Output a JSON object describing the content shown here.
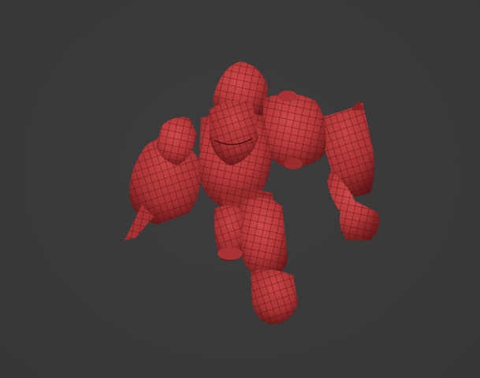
{
  "viewport": {
    "background_color": "#3a3a3a",
    "mesh_color": "#b5383a",
    "mesh_shadow_color": "#6e1a1c",
    "wire_color": "#4a0e10"
  },
  "model": {
    "subject": "armored-hulk-robot-wireframe-mesh"
  }
}
